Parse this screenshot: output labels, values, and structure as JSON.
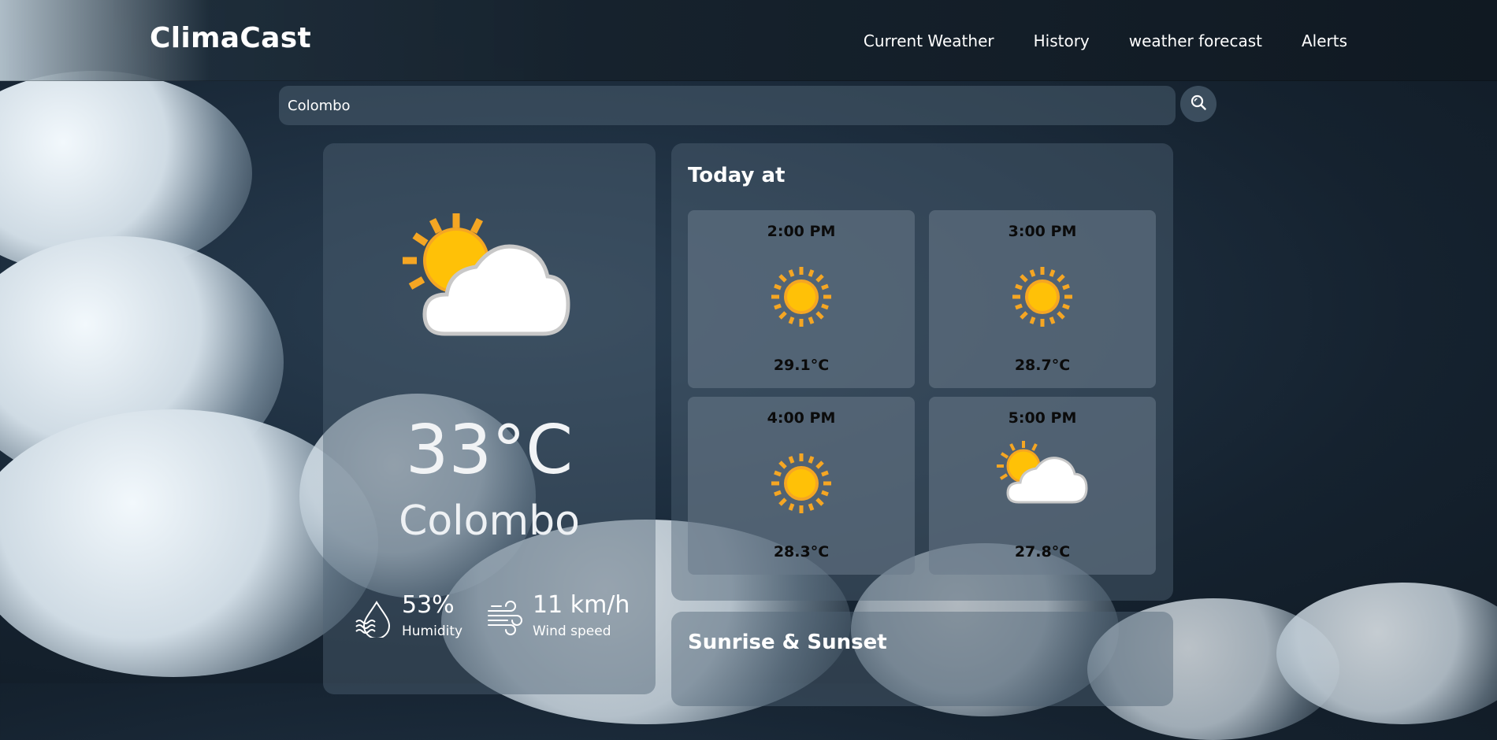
{
  "app": {
    "name": "ClimaCast"
  },
  "nav": {
    "items": [
      {
        "label": "Current Weather"
      },
      {
        "label": "History"
      },
      {
        "label": "weather forecast"
      },
      {
        "label": "Alerts"
      }
    ]
  },
  "search": {
    "value": "Colombo",
    "button_icon": "search-icon"
  },
  "current": {
    "icon": "partly-cloudy-icon",
    "temperature": "33°C",
    "city": "Colombo",
    "humidity_value": "53%",
    "humidity_label": "Humidity",
    "wind_value": "11 km/h",
    "wind_label": "Wind speed"
  },
  "today": {
    "title": "Today at",
    "hours": [
      {
        "time": "2:00 PM",
        "temp": "29.1°C",
        "icon": "sunny-icon"
      },
      {
        "time": "3:00 PM",
        "temp": "28.7°C",
        "icon": "sunny-icon"
      },
      {
        "time": "4:00 PM",
        "temp": "28.3°C",
        "icon": "sunny-icon"
      },
      {
        "time": "5:00 PM",
        "temp": "27.8°C",
        "icon": "partly-cloudy-icon"
      }
    ]
  },
  "sun": {
    "title": "Sunrise & Sunset"
  },
  "colors": {
    "sun": "#FFC107",
    "sun_ray": "#F5A623",
    "cloud": "#FFFFFF"
  }
}
